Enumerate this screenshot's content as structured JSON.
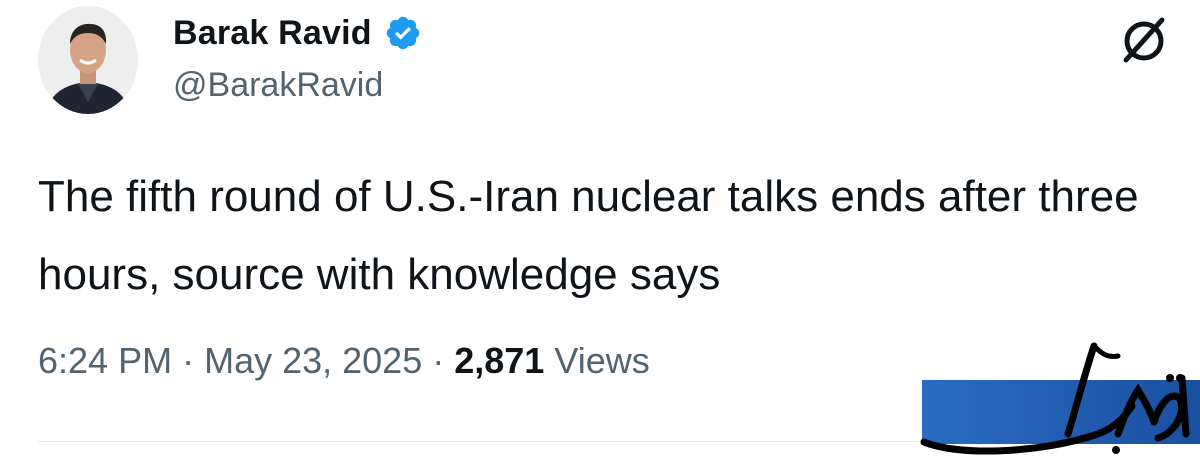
{
  "author": {
    "name": "Barak Ravid",
    "handle": "@BarakRavid",
    "verified": true
  },
  "tweet": {
    "text": "The fifth round of U.S.-Iran nuclear talks ends after three hours, source with knowledge says"
  },
  "meta": {
    "time": "6:24 PM",
    "separator": "·",
    "date": "May 23, 2025",
    "views_count": "2,871",
    "views_label": "Views"
  },
  "watermark": {
    "text": "تابناک"
  },
  "colors": {
    "verified_blue": "#1d9bf0",
    "secondary_text": "#536471",
    "watermark_blue": "#1f5db5"
  },
  "icons": {
    "top_right": "grok-slash-icon"
  }
}
